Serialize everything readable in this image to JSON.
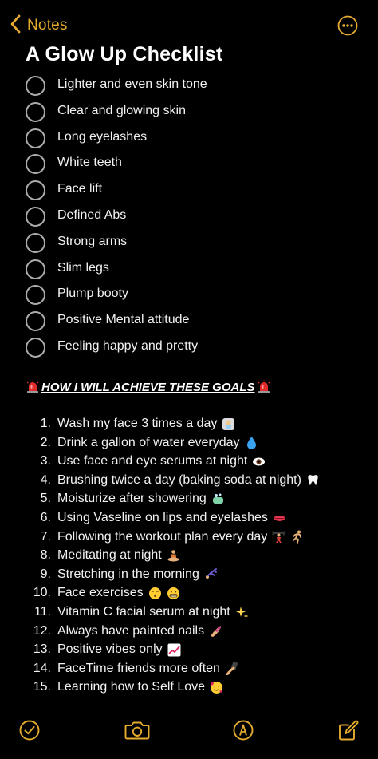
{
  "nav": {
    "back_label": "Notes"
  },
  "note": {
    "title": "A Glow Up Checklist"
  },
  "checklist": [
    "Lighter and even skin tone",
    "Clear and glowing skin",
    "Long eyelashes",
    "White teeth",
    "Face lift",
    "Defined Abs",
    "Strong arms",
    "Slim legs",
    "Plump booty",
    "Positive Mental attitude",
    "Feeling happy and pretty"
  ],
  "section": {
    "heading": "HOW I WILL ACHIEVE THESE GOALS",
    "icon": "police-light-emoji"
  },
  "steps": [
    {
      "num": "1.",
      "text": "Wash my face 3 times a day",
      "emojis": [
        "shower-emoji"
      ]
    },
    {
      "num": "2.",
      "text": "Drink a gallon of water everyday",
      "emojis": [
        "droplet-emoji"
      ]
    },
    {
      "num": "3.",
      "text": "Use face and eye serums at night",
      "emojis": [
        "eye-emoji"
      ]
    },
    {
      "num": "4.",
      "text": "Brushing twice a day (baking soda at night)",
      "emojis": [
        "tooth-emoji"
      ]
    },
    {
      "num": "5.",
      "text": "Moisturize after showering",
      "emojis": [
        "soap-emoji"
      ]
    },
    {
      "num": "6.",
      "text": "Using Vaseline on lips and eyelashes",
      "emojis": [
        "lips-emoji"
      ]
    },
    {
      "num": "7.",
      "text": "Following the workout plan every day",
      "emojis": [
        "weightlifter-emoji",
        "runner-emoji"
      ]
    },
    {
      "num": "8.",
      "text": "Meditating at night",
      "emojis": [
        "meditation-emoji"
      ]
    },
    {
      "num": "9.",
      "text": "Stretching in the morning",
      "emojis": [
        "cartwheel-emoji"
      ]
    },
    {
      "num": "10.",
      "text": "Face exercises",
      "emojis": [
        "kissing-face-emoji",
        "grimacing-face-emoji"
      ]
    },
    {
      "num": "11.",
      "text": "Vitamin C facial serum at night",
      "emojis": [
        "sparkles-emoji"
      ]
    },
    {
      "num": "12.",
      "text": "Always have painted nails",
      "emojis": [
        "nail-polish-emoji"
      ]
    },
    {
      "num": "13.",
      "text": "Positive vibes only",
      "emojis": [
        "chart-increasing-emoji"
      ]
    },
    {
      "num": "14.",
      "text": "FaceTime friends more often",
      "emojis": [
        "selfie-emoji"
      ]
    },
    {
      "num": "15.",
      "text": "Learning how to Self Love",
      "emojis": [
        "smiling-face-hearts-emoji"
      ]
    }
  ],
  "toolbar": {
    "items": [
      "checklist-icon",
      "camera-icon",
      "markup-icon",
      "compose-icon"
    ]
  },
  "colors": {
    "accent": "#e5ac2f",
    "background": "#000000",
    "text": "#f2f2f2",
    "checkbox_border": "#ababab"
  }
}
